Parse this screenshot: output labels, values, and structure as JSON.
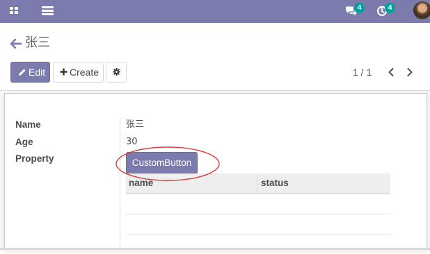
{
  "navbar": {
    "apps_icon": "apps-grid-icon",
    "menu_icon": "hamburger-menu-icon",
    "messages_icon": "chat-bubbles-icon",
    "messages_count": "4",
    "activities_icon": "clock-activity-icon",
    "activities_count": "4",
    "avatar_icon": "user-avatar",
    "accent": "#7c7bad"
  },
  "breadcrumb": {
    "back_icon": "arrow-left-icon",
    "title": "张三"
  },
  "toolbar": {
    "edit_label": "Edit",
    "edit_icon": "pencil-icon",
    "create_label": "Create",
    "create_icon": "plus-icon",
    "settings_icon": "gear-icon"
  },
  "pager": {
    "text": "1 / 1",
    "prev_icon": "chevron-left-icon",
    "next_icon": "chevron-right-icon"
  },
  "form": {
    "fields": [
      {
        "label": "Name",
        "value": "张三"
      },
      {
        "label": "Age",
        "value": "30"
      },
      {
        "label": "Property",
        "value": ""
      }
    ],
    "custom_button_label": "CustomButton",
    "highlight_color": "#d63c3c",
    "grid": {
      "columns": [
        "name",
        "status"
      ],
      "rows": [
        [
          "",
          ""
        ],
        [
          "",
          ""
        ],
        [
          "",
          ""
        ]
      ]
    }
  }
}
